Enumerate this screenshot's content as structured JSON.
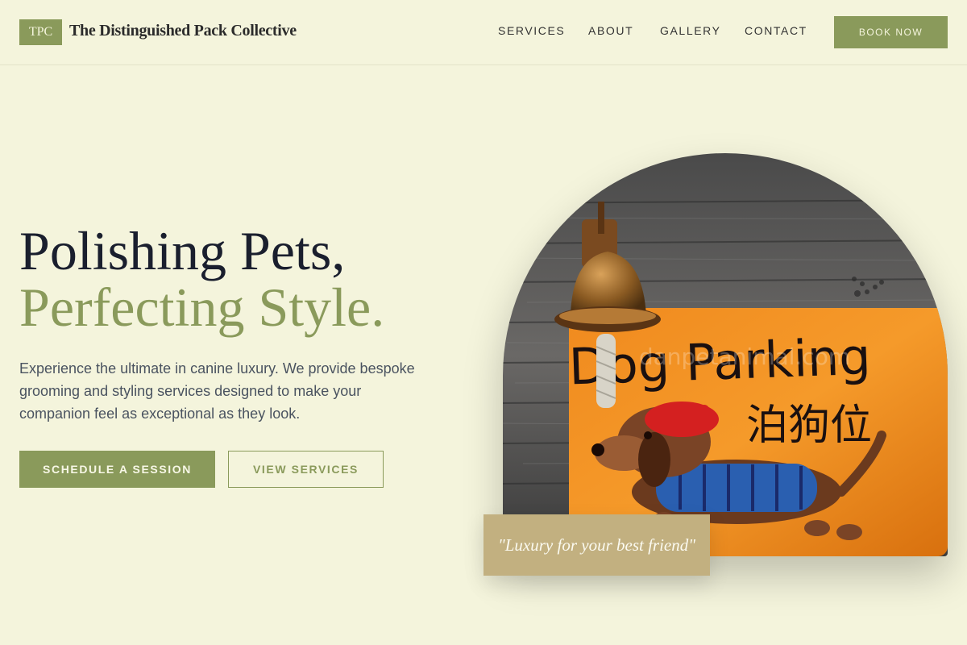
{
  "brand": {
    "badge": "TPC",
    "name": "The Distinguished Pack Collective"
  },
  "nav": {
    "items": [
      {
        "label": "SERVICES"
      },
      {
        "label": "ABOUT"
      },
      {
        "label": "GALLERY"
      },
      {
        "label": "CONTACT"
      }
    ],
    "book_label": "BOOK NOW"
  },
  "hero": {
    "title_line1": "Polishing Pets,",
    "title_line2": "Perfecting Style.",
    "description": "Experience the ultimate in canine luxury. We provide bespoke grooming and styling services designed to make your companion feel as exceptional as they look.",
    "primary_cta": "SCHEDULE A SESSION",
    "secondary_cta": "VIEW SERVICES",
    "quote": "\"Luxury for your best friend\""
  },
  "image": {
    "sign_text": "Dog Parking",
    "sign_subtext": "泊狗位",
    "watermark": "danpetanimal.com"
  },
  "colors": {
    "background": "#f4f4dc",
    "accent_green": "#8a9a5b",
    "quote_tan": "#c2b080",
    "heading_dark": "#1a1f2e"
  }
}
